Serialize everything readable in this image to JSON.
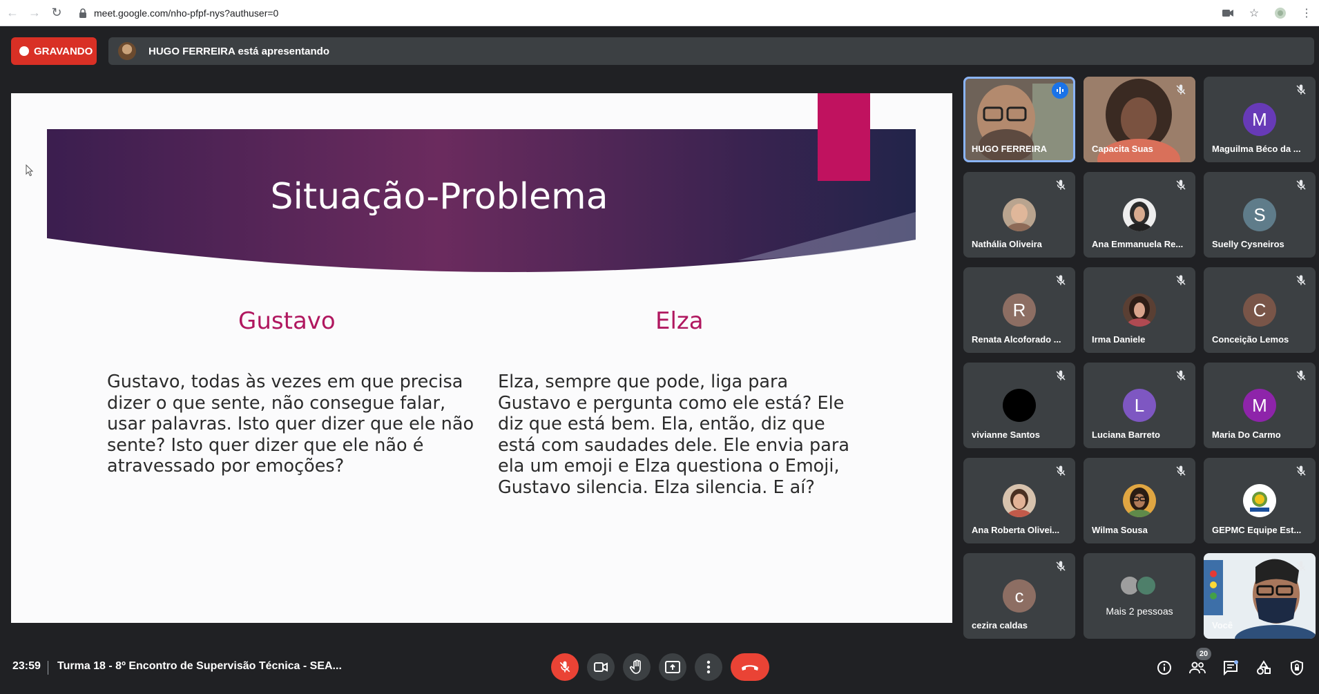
{
  "browser": {
    "url": "meet.google.com/nho-pfpf-nys?authuser=0"
  },
  "recording": {
    "label": "GRAVANDO"
  },
  "presenter": {
    "text": "HUGO FERREIRA está apresentando"
  },
  "slide": {
    "title": "Situação-Problema",
    "col1": {
      "heading": "Gustavo",
      "lines": [
        "Gustavo, todas às vezes em que precisa",
        "dizer o que sente, não consegue falar,",
        "usar palavras. Isto quer dizer que ele não",
        "sente? Isto quer dizer que ele não é",
        "atravessado por emoções?"
      ]
    },
    "col2": {
      "heading": "Elza",
      "lines": [
        "Elza, sempre que pode, liga para",
        "Gustavo e pergunta como ele está? Ele",
        "diz que está bem. Ela, então, diz que",
        "está com saudades dele. Ele envia para",
        "ela um emoji e Elza questiona o Emoji,",
        "Gustavo silencia. Elza silencia. E aí?"
      ]
    }
  },
  "participants": {
    "p1": {
      "name": "HUGO FERREIRA"
    },
    "p2": {
      "name": "Capacita Suas"
    },
    "p3": {
      "name": "Maguilma Béco da ...",
      "initial": "M",
      "color": "#673ab7"
    },
    "p4": {
      "name": "Nathália Oliveira"
    },
    "p5": {
      "name": "Ana Emmanuela Re..."
    },
    "p6": {
      "name": "Suelly Cysneiros",
      "initial": "S",
      "color": "#5f7c8a"
    },
    "p7": {
      "name": "Renata Alcoforado ...",
      "initial": "R",
      "color": "#8d6e63"
    },
    "p8": {
      "name": "Irma Daniele"
    },
    "p9": {
      "name": "Conceição Lemos",
      "initial": "C",
      "color": "#795548"
    },
    "p10": {
      "name": "vivianne Santos"
    },
    "p11": {
      "name": "Luciana Barreto",
      "initial": "L",
      "color": "#7e57c2"
    },
    "p12": {
      "name": "Maria Do Carmo",
      "initial": "M",
      "color": "#8e24aa"
    },
    "p13": {
      "name": "Ana Roberta Olivei..."
    },
    "p14": {
      "name": "Wilma Sousa"
    },
    "p15": {
      "name": "GEPMC Equipe Est..."
    },
    "p16": {
      "name": "cezira caldas",
      "initial": "c",
      "color": "#8d6e63"
    },
    "p17": {
      "name": "Mais 2 pessoas"
    },
    "p18": {
      "name": "Você"
    }
  },
  "bottom": {
    "time": "23:59",
    "meeting": "Turma 18 - 8º Encontro de Supervisão Técnica - SEA...",
    "people_count": "20"
  },
  "colors": {
    "record_red": "#d93025",
    "accent_pink": "#c0125f",
    "active_outline": "#8ab4f8"
  }
}
